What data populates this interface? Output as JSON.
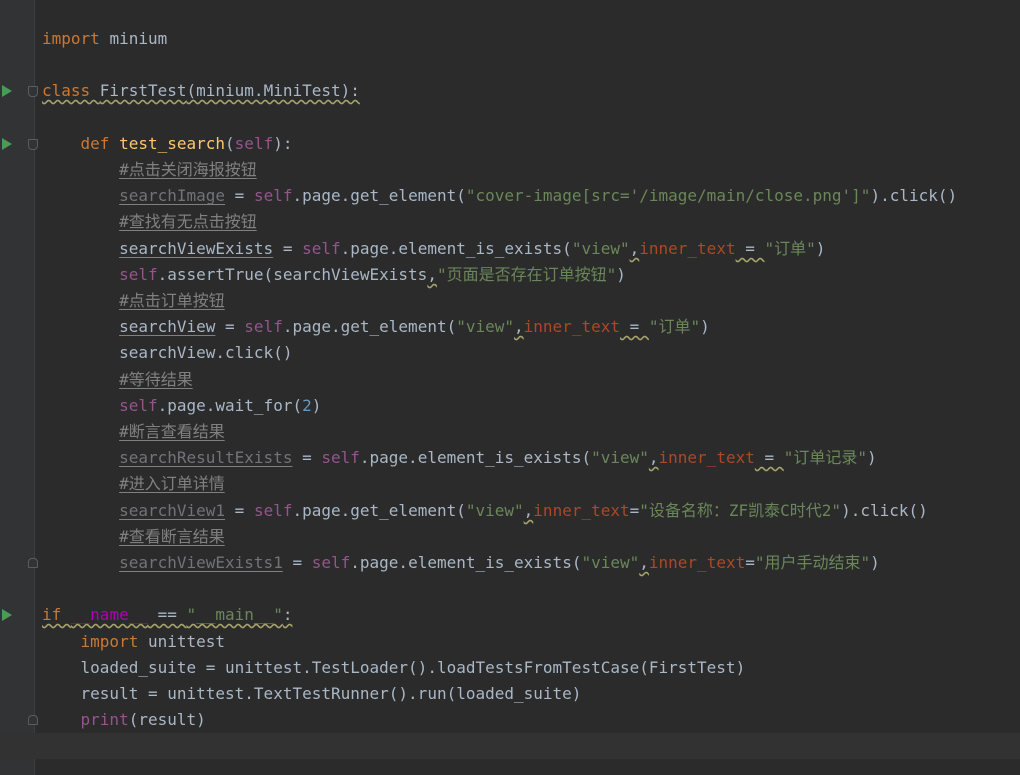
{
  "editor": {
    "background": "#2b2b2b",
    "gutter_background": "#313335",
    "run_icon_color": "#499c54",
    "lines": [
      {
        "tokens": [
          {
            "t": "import ",
            "c": "kw"
          },
          {
            "t": "minium",
            "c": ""
          }
        ]
      },
      {
        "tokens": []
      },
      {
        "tokens": [
          {
            "t": "class ",
            "c": "kw wavy"
          },
          {
            "t": "FirstTest",
            "c": "cls wavy"
          },
          {
            "t": "(minium.MiniTest):",
            "c": "wavy"
          }
        ],
        "run": true,
        "fold": "start"
      },
      {
        "tokens": []
      },
      {
        "tokens": [
          {
            "t": "    "
          },
          {
            "t": "def ",
            "c": "kw"
          },
          {
            "t": "test_search",
            "c": "fn"
          },
          {
            "t": "("
          },
          {
            "t": "self",
            "c": "self"
          },
          {
            "t": "):"
          }
        ],
        "run": true,
        "fold": "start"
      },
      {
        "tokens": [
          {
            "t": "        "
          },
          {
            "t": "#点击关闭海报按钮",
            "c": "cmt und"
          }
        ]
      },
      {
        "tokens": [
          {
            "t": "        "
          },
          {
            "t": "searchImage",
            "c": "unused und"
          },
          {
            "t": " = "
          },
          {
            "t": "self",
            "c": "self"
          },
          {
            "t": ".page.get_element("
          },
          {
            "t": "\"cover-image[src='/image/main/close.png']\"",
            "c": "str"
          },
          {
            "t": ").click()"
          }
        ]
      },
      {
        "tokens": [
          {
            "t": "        "
          },
          {
            "t": "#查找有无点击按钮",
            "c": "cmt und"
          }
        ]
      },
      {
        "tokens": [
          {
            "t": "        "
          },
          {
            "t": "searchViewExists",
            "c": "und"
          },
          {
            "t": " = "
          },
          {
            "t": "self",
            "c": "self"
          },
          {
            "t": ".page.element_is_exists("
          },
          {
            "t": "\"view\"",
            "c": "str"
          },
          {
            "t": ",",
            "c": "wavy"
          },
          {
            "t": "inner_text",
            "c": "param"
          },
          {
            "t": " = ",
            "c": "wavy"
          },
          {
            "t": "\"订单\"",
            "c": "str"
          },
          {
            "t": ")"
          }
        ]
      },
      {
        "tokens": [
          {
            "t": "        "
          },
          {
            "t": "self",
            "c": "self"
          },
          {
            "t": ".assertTrue(searchViewExists"
          },
          {
            "t": ",",
            "c": "wavy"
          },
          {
            "t": "\"页面是否存在订单按钮\"",
            "c": "str"
          },
          {
            "t": ")"
          }
        ]
      },
      {
        "tokens": [
          {
            "t": "        "
          },
          {
            "t": "#点击订单按钮",
            "c": "cmt und"
          }
        ]
      },
      {
        "tokens": [
          {
            "t": "        "
          },
          {
            "t": "searchView",
            "c": "und"
          },
          {
            "t": " = "
          },
          {
            "t": "self",
            "c": "self"
          },
          {
            "t": ".page.get_element("
          },
          {
            "t": "\"view\"",
            "c": "str"
          },
          {
            "t": ",",
            "c": "wavy"
          },
          {
            "t": "inner_text",
            "c": "param"
          },
          {
            "t": " = ",
            "c": "wavy"
          },
          {
            "t": "\"订单\"",
            "c": "str"
          },
          {
            "t": ")"
          }
        ]
      },
      {
        "tokens": [
          {
            "t": "        "
          },
          {
            "t": "searchView.click()"
          }
        ]
      },
      {
        "tokens": [
          {
            "t": "        "
          },
          {
            "t": "#等待结果",
            "c": "cmt und"
          }
        ]
      },
      {
        "tokens": [
          {
            "t": "        "
          },
          {
            "t": "self",
            "c": "self"
          },
          {
            "t": ".page.wait_for("
          },
          {
            "t": "2",
            "c": "num"
          },
          {
            "t": ")"
          }
        ]
      },
      {
        "tokens": [
          {
            "t": "        "
          },
          {
            "t": "#断言查看结果",
            "c": "cmt und"
          }
        ]
      },
      {
        "tokens": [
          {
            "t": "        "
          },
          {
            "t": "searchResultExists",
            "c": "unused und"
          },
          {
            "t": " = "
          },
          {
            "t": "self",
            "c": "self"
          },
          {
            "t": ".page.element_is_exists("
          },
          {
            "t": "\"view\"",
            "c": "str"
          },
          {
            "t": ",",
            "c": "wavy"
          },
          {
            "t": "inner_text",
            "c": "param"
          },
          {
            "t": " = ",
            "c": "wavy"
          },
          {
            "t": "\"订单记录\"",
            "c": "str"
          },
          {
            "t": ")"
          }
        ]
      },
      {
        "tokens": [
          {
            "t": "        "
          },
          {
            "t": "#进入订单详情",
            "c": "cmt und"
          }
        ]
      },
      {
        "tokens": [
          {
            "t": "        "
          },
          {
            "t": "searchView1",
            "c": "unused und"
          },
          {
            "t": " = "
          },
          {
            "t": "self",
            "c": "self"
          },
          {
            "t": ".page.get_element("
          },
          {
            "t": "\"view\"",
            "c": "str"
          },
          {
            "t": ",",
            "c": "wavy"
          },
          {
            "t": "inner_text",
            "c": "param"
          },
          {
            "t": "="
          },
          {
            "t": "\"设备名称：ZF凯泰C时代2\"",
            "c": "str"
          },
          {
            "t": ").click()"
          }
        ]
      },
      {
        "tokens": [
          {
            "t": "        "
          },
          {
            "t": "#查看断言结果",
            "c": "cmt und"
          }
        ]
      },
      {
        "tokens": [
          {
            "t": "        "
          },
          {
            "t": "searchViewExists1",
            "c": "unused und"
          },
          {
            "t": " = "
          },
          {
            "t": "self",
            "c": "self"
          },
          {
            "t": ".page.element_is_exists("
          },
          {
            "t": "\"view\"",
            "c": "str"
          },
          {
            "t": ",",
            "c": "wavy"
          },
          {
            "t": "inner_text",
            "c": "param"
          },
          {
            "t": "="
          },
          {
            "t": "\"用户手动结束\"",
            "c": "str"
          },
          {
            "t": ")"
          }
        ],
        "fold": "end"
      },
      {
        "tokens": []
      },
      {
        "tokens": [
          {
            "t": "if ",
            "c": "kw wavy"
          },
          {
            "t": "__name__",
            "c": "dunder wavy"
          },
          {
            "t": " == ",
            "c": "wavy"
          },
          {
            "t": "\"__main__\"",
            "c": "str wavy"
          },
          {
            "t": ":",
            "c": "wavy"
          }
        ],
        "run": true
      },
      {
        "tokens": [
          {
            "t": "    "
          },
          {
            "t": "import ",
            "c": "kw"
          },
          {
            "t": "unittest"
          }
        ]
      },
      {
        "tokens": [
          {
            "t": "    "
          },
          {
            "t": "loaded_suite = unittest.TestLoader().loadTestsFromTestCase(FirstTest)"
          }
        ]
      },
      {
        "tokens": [
          {
            "t": "    "
          },
          {
            "t": "result = unittest.TextTestRunner().run(loaded_suite)"
          }
        ]
      },
      {
        "tokens": [
          {
            "t": "    "
          },
          {
            "t": "print",
            "c": "self"
          },
          {
            "t": "(result)"
          }
        ],
        "fold": "end"
      },
      {
        "tokens": [],
        "current": true
      }
    ]
  }
}
